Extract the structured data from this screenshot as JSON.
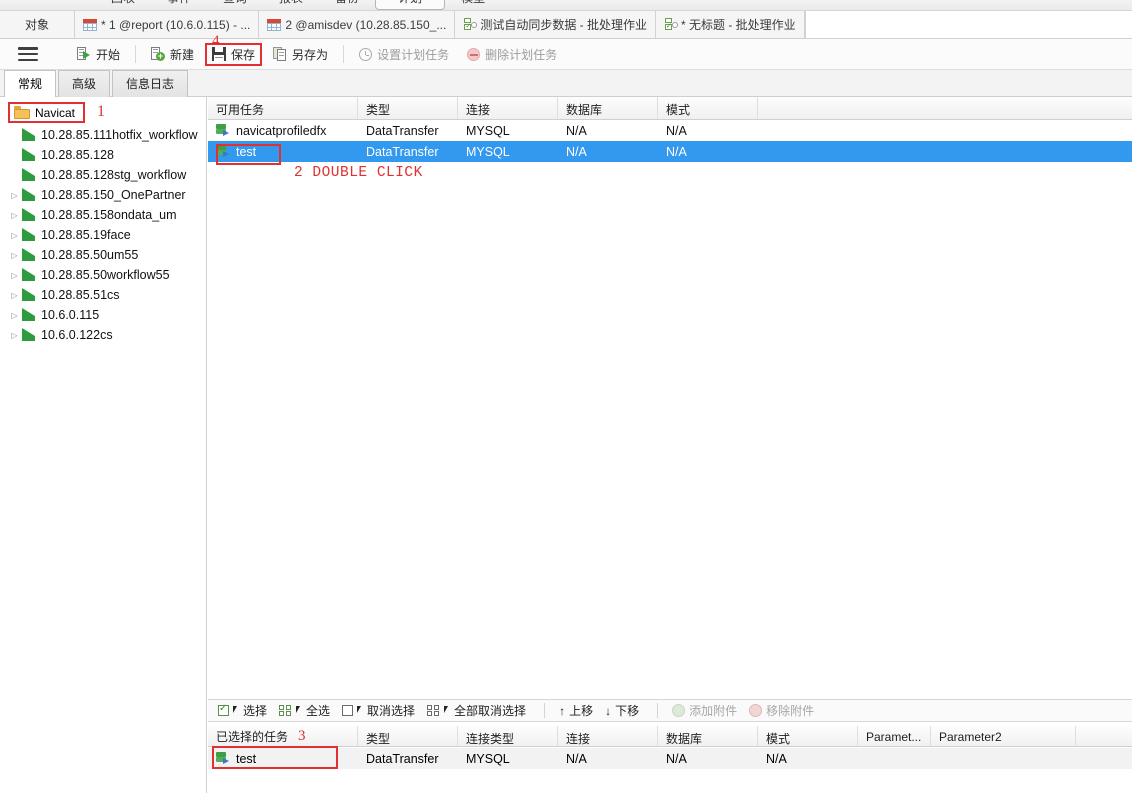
{
  "menubar": {
    "items": [
      {
        "label": "回收",
        "active": false
      },
      {
        "label": "事件",
        "active": false
      },
      {
        "label": "查询",
        "active": false
      },
      {
        "label": "报表",
        "active": false
      },
      {
        "label": "备份",
        "active": false
      },
      {
        "label": "计划",
        "active": true
      },
      {
        "label": "模型",
        "active": false
      }
    ]
  },
  "tabstrip": {
    "objects_label": "对象",
    "tabs": [
      {
        "label": "* 1 @report (10.6.0.115) - ...",
        "icon": "table-grid-icon",
        "active": false
      },
      {
        "label": "2 @amisdev (10.28.85.150_...",
        "icon": "table-grid-icon",
        "active": false
      },
      {
        "label": "测试自动同步数据 - 批处理作业",
        "icon": "batch-job-icon",
        "active": false
      },
      {
        "label": "* 无标题 - 批处理作业",
        "icon": "batch-job-icon",
        "active": true
      }
    ]
  },
  "toolbar": {
    "menu_icon": "hamburger-icon",
    "buttons": [
      {
        "label": "开始",
        "icon": "start-icon",
        "disabled": false,
        "highlighted": false
      },
      {
        "label": "新建",
        "icon": "new-icon",
        "disabled": false,
        "highlighted": false
      },
      {
        "label": "保存",
        "icon": "save-icon",
        "disabled": false,
        "highlighted": true
      },
      {
        "label": "另存为",
        "icon": "save-as-icon",
        "disabled": false,
        "highlighted": false
      },
      {
        "label": "设置计划任务",
        "icon": "clock-icon",
        "disabled": true,
        "highlighted": false
      },
      {
        "label": "删除计划任务",
        "icon": "delete-clock-icon",
        "disabled": true,
        "highlighted": false
      }
    ]
  },
  "inner_tabs": [
    {
      "label": "常规",
      "active": true
    },
    {
      "label": "高级",
      "active": false
    },
    {
      "label": "信息日志",
      "active": false
    }
  ],
  "sidebar": {
    "root": {
      "label": "Navicat",
      "icon": "folder-icon",
      "highlighted": true
    },
    "items": [
      {
        "label": "10.28.85.111hotfix_workflow",
        "expandable": false
      },
      {
        "label": "10.28.85.128",
        "expandable": false
      },
      {
        "label": "10.28.85.128stg_workflow",
        "expandable": false
      },
      {
        "label": "10.28.85.150_OnePartner",
        "expandable": true
      },
      {
        "label": "10.28.85.158ondata_um",
        "expandable": true
      },
      {
        "label": "10.28.85.19face",
        "expandable": true
      },
      {
        "label": "10.28.85.50um55",
        "expandable": true
      },
      {
        "label": "10.28.85.50workflow55",
        "expandable": true
      },
      {
        "label": "10.28.85.51cs",
        "expandable": true
      },
      {
        "label": "10.6.0.115",
        "expandable": true
      },
      {
        "label": "10.6.0.122cs",
        "expandable": true
      }
    ]
  },
  "available_tasks": {
    "columns": [
      "可用任务",
      "类型",
      "连接",
      "数据库",
      "模式"
    ],
    "rows": [
      {
        "name": "navicatprofiledfx",
        "type": "DataTransfer",
        "connection": "MYSQL",
        "database": "N/A",
        "schema": "N/A",
        "selected": false
      },
      {
        "name": "test",
        "type": "DataTransfer",
        "connection": "MYSQL",
        "database": "N/A",
        "schema": "N/A",
        "selected": true
      }
    ]
  },
  "bottom_toolbar": {
    "buttons": [
      {
        "label": "选择",
        "icon": "check-select-icon",
        "disabled": false
      },
      {
        "label": "全选",
        "icon": "select-all-icon",
        "disabled": false
      },
      {
        "label": "取消选择",
        "icon": "deselect-icon",
        "disabled": false
      },
      {
        "label": "全部取消选择",
        "icon": "deselect-all-icon",
        "disabled": false
      },
      {
        "label": "上移",
        "icon": "arrow-up-icon",
        "disabled": false
      },
      {
        "label": "下移",
        "icon": "arrow-down-icon",
        "disabled": false
      },
      {
        "label": "添加附件",
        "icon": "add-attachment-icon",
        "disabled": true
      },
      {
        "label": "移除附件",
        "icon": "remove-attachment-icon",
        "disabled": true
      }
    ]
  },
  "selected_tasks": {
    "columns": [
      "已选择的任务",
      "类型",
      "连接类型",
      "连接",
      "数据库",
      "模式",
      "Paramet...",
      "Parameter2"
    ],
    "rows": [
      {
        "name": "test",
        "type": "DataTransfer",
        "conn_type": "MYSQL",
        "connection": "N/A",
        "database": "N/A",
        "schema": "N/A",
        "param1": "",
        "param2": "",
        "highlighted": true
      }
    ]
  },
  "annotations": [
    {
      "id": "a1",
      "text": "1"
    },
    {
      "id": "a2",
      "text": "2 DOUBLE CLICK"
    },
    {
      "id": "a3",
      "text": "3"
    },
    {
      "id": "a4",
      "text": "4"
    }
  ],
  "colors": {
    "accent_selection": "#3399ef",
    "annotation_red": "#e03030",
    "db_icon_green": "#2e9c3e"
  }
}
